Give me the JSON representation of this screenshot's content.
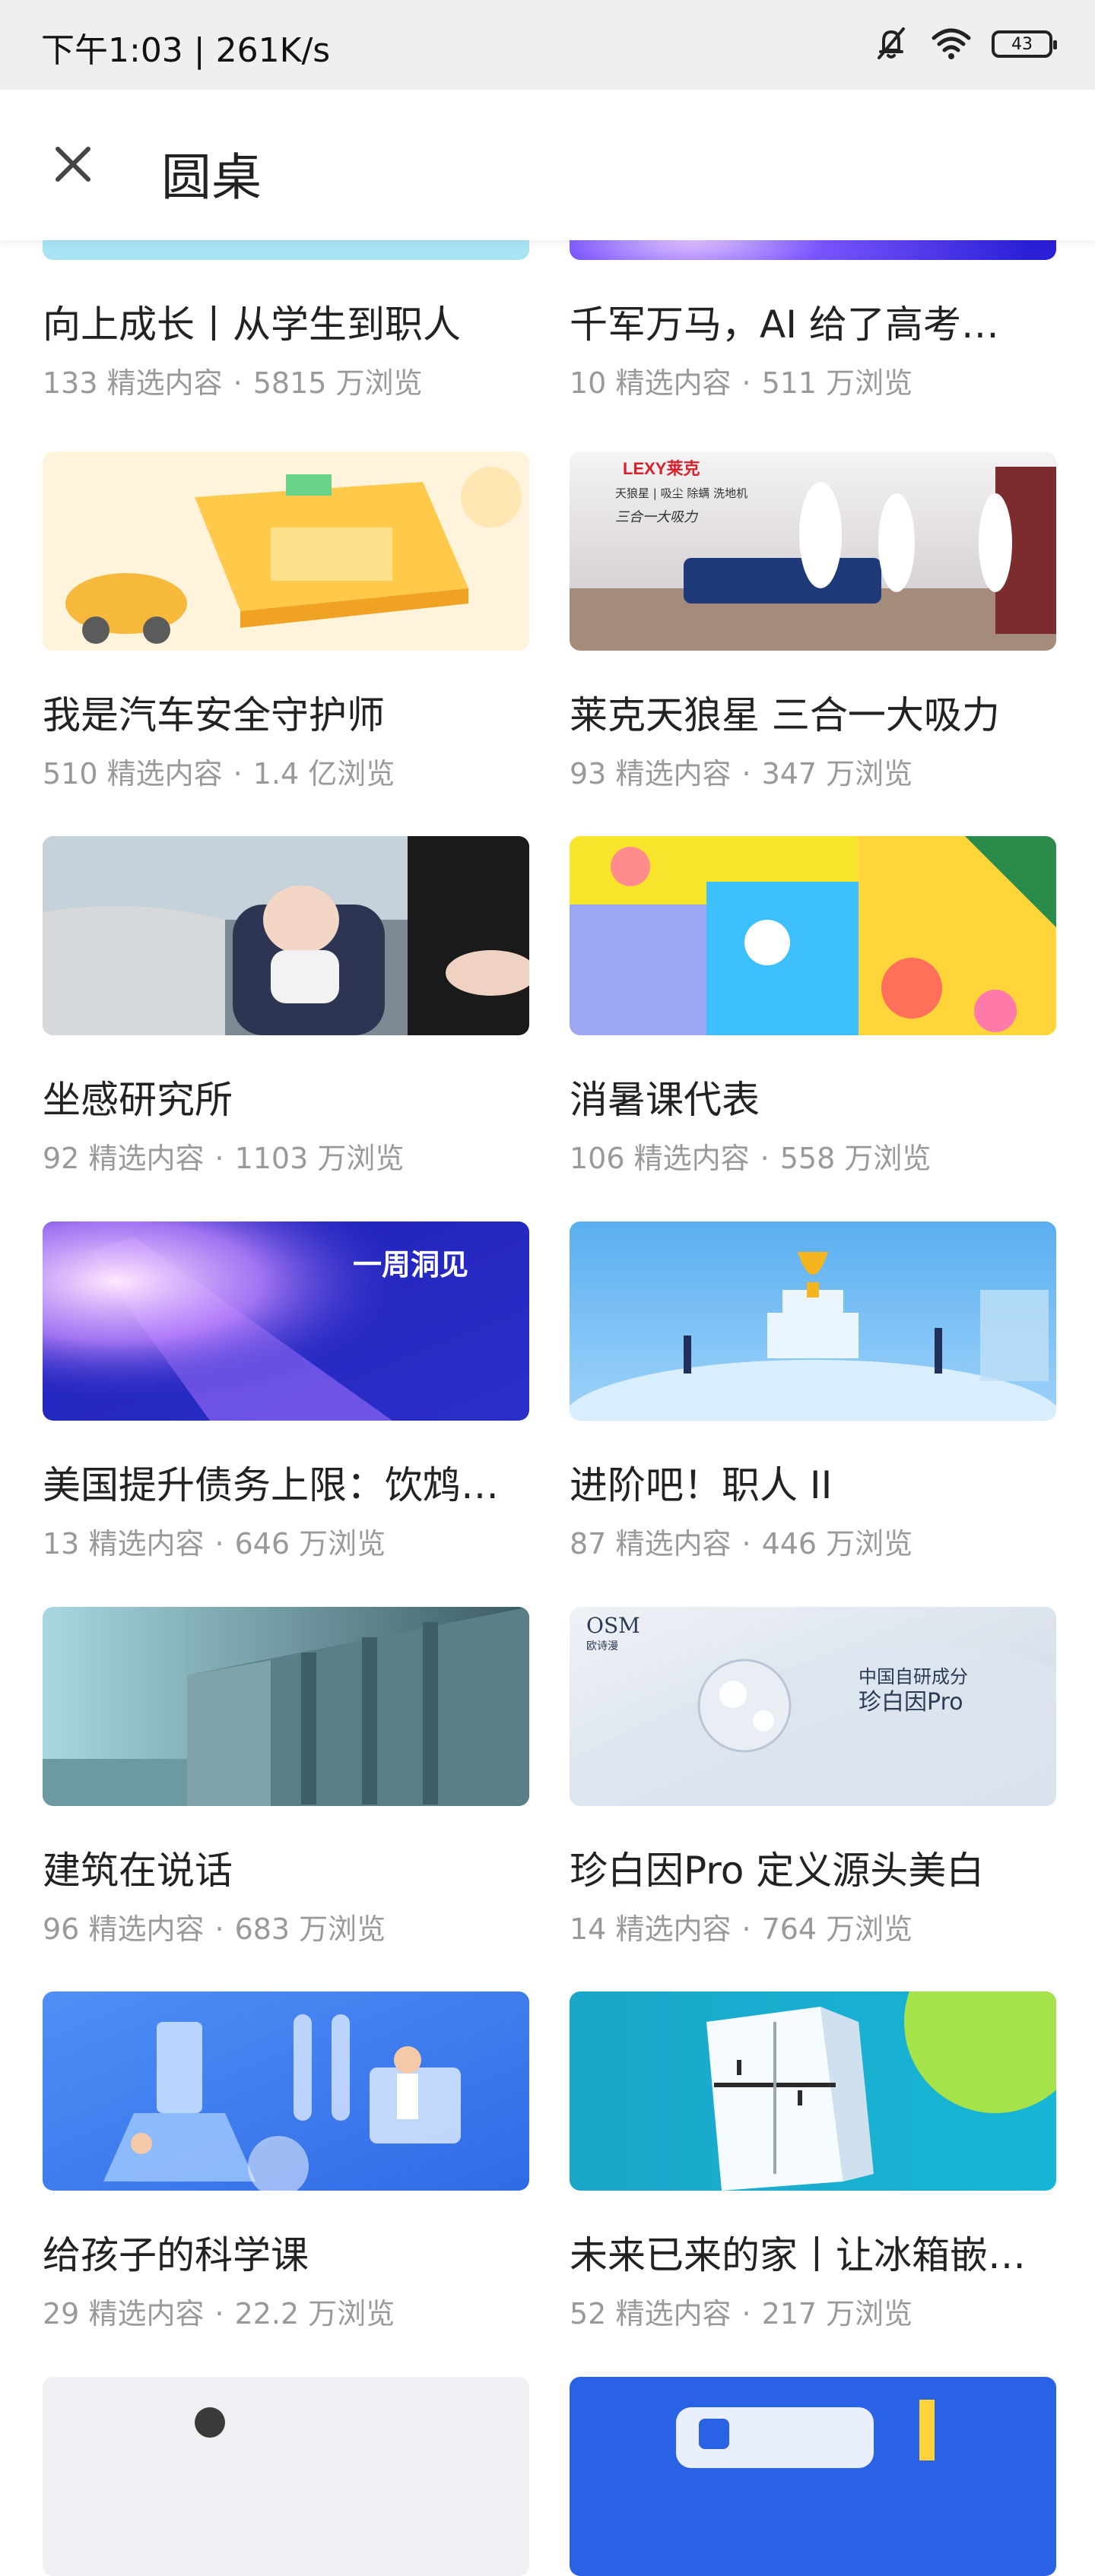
{
  "status_bar": {
    "time": "下午1:03 | 261K/s",
    "battery": "43"
  },
  "header": {
    "title": "圆桌"
  },
  "labels": {
    "items_suffix": "精选内容",
    "dot": "·"
  },
  "cards": [
    {
      "title": "向上成长丨从学生到职人",
      "count": "133",
      "views": "5815 万浏览"
    },
    {
      "title": "千军万马，AI 给了高考…",
      "count": "10",
      "views": "511 万浏览"
    },
    {
      "title": "我是汽车安全守护师",
      "count": "510",
      "views": "1.4 亿浏览"
    },
    {
      "title": "莱克天狼星 三合一大吸力",
      "count": "93",
      "views": "347 万浏览"
    },
    {
      "title": "坐感研究所",
      "count": "92",
      "views": "1103 万浏览"
    },
    {
      "title": "消暑课代表",
      "count": "106",
      "views": "558 万浏览"
    },
    {
      "title": "美国提升债务上限：饮鸩…",
      "count": "13",
      "views": "646 万浏览"
    },
    {
      "title": "进阶吧！职人 II",
      "count": "87",
      "views": "446 万浏览"
    },
    {
      "title": "建筑在说话",
      "count": "96",
      "views": "683 万浏览"
    },
    {
      "title": "珍白因Pro 定义源头美白",
      "count": "14",
      "views": "764 万浏览"
    },
    {
      "title": "给孩子的科学课",
      "count": "29",
      "views": "22.2 万浏览"
    },
    {
      "title": "未来已来的家丨让冰箱嵌…",
      "count": "52",
      "views": "217 万浏览"
    }
  ],
  "thumb_texts": {
    "lexy_brand": "LEXY莱克",
    "lexy_sub": "天狼星 | 吸尘 除螨 洗地机",
    "lexy_slogan": "三合一大吸力",
    "weekly": "一周洞见",
    "osm_brand": "OSM",
    "osm_brand_cn": "欧诗漫",
    "osm_line1": "中国自研成分",
    "osm_line2": "珍白因Pro"
  }
}
